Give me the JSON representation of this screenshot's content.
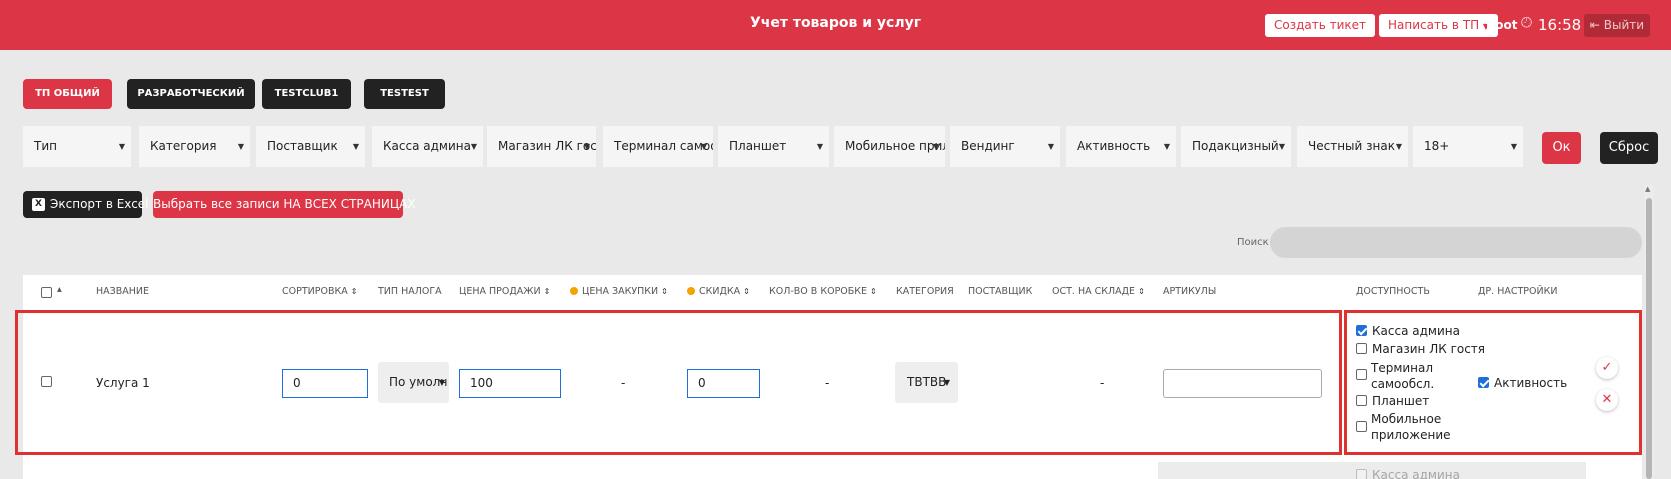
{
  "header": {
    "title": "Учет товаров и услуг",
    "create_ticket": "Создать тикет",
    "write_support": "Написать в ТП",
    "user": "Root",
    "time": "16:58",
    "logout": "Выйти"
  },
  "tabs": [
    {
      "label": "ТП ОБЩИЙ"
    },
    {
      "label": "РАЗРАБОТЧЕСКИЙ"
    },
    {
      "label": "TESTCLUB1"
    },
    {
      "label": "TESTEST"
    }
  ],
  "filters": [
    {
      "label": "Тип"
    },
    {
      "label": "Категория"
    },
    {
      "label": "Поставщик"
    },
    {
      "label": "Касса админа"
    },
    {
      "label": "Магазин ЛК гостя"
    },
    {
      "label": "Терминал самообс"
    },
    {
      "label": "Планшет"
    },
    {
      "label": "Мобильное прило"
    },
    {
      "label": "Вендинг"
    },
    {
      "label": "Активность"
    },
    {
      "label": "Подакцизный"
    },
    {
      "label": "Честный знак"
    },
    {
      "label": "18+"
    }
  ],
  "filter_buttons": {
    "ok": "Ок",
    "reset": "Сброс"
  },
  "actions": {
    "export_excel": "Экспорт в Excel",
    "select_all_pages": "Выбрать все записи НА ВСЕХ СТРАНИЦАХ"
  },
  "search": {
    "label": "Поиск",
    "placeholder": ""
  },
  "columns": {
    "name": "НАЗВАНИЕ",
    "sort": "СОРТИРОВКА",
    "tax_type": "ТИП НАЛОГА",
    "sale_price": "ЦЕНА ПРОДАЖИ",
    "purchase_price": "ЦЕНА ЗАКУПКИ",
    "discount": "СКИДКА",
    "box_qty": "КОЛ-ВО В КОРОБКЕ",
    "category": "КАТЕГОРИЯ",
    "supplier": "ПОСТАВЩИК",
    "stock": "ОСТ. НА СКЛАДЕ",
    "articles": "АРТИКУЛЫ",
    "availability": "ДОСТУПНОСТЬ",
    "other_settings": "ДР. НАСТРОЙКИ"
  },
  "row": {
    "name": "Услуга 1",
    "sort": "0",
    "tax_type": "По умолч",
    "sale_price": "100",
    "purchase_price": "-",
    "discount": "0",
    "box_qty": "-",
    "category": "ТВТВВ",
    "stock": "-",
    "articles": "",
    "availability": [
      {
        "label": "Касса админа",
        "checked": true
      },
      {
        "label": "Магазин ЛК гостя",
        "checked": false
      },
      {
        "label_line1": "Терминал",
        "label_line2": "самообсл.",
        "checked": false
      },
      {
        "label": "Планшет",
        "checked": false
      },
      {
        "label_line1": "Мобильное",
        "label_line2": "приложение",
        "checked": false
      }
    ],
    "activity": {
      "label": "Активность",
      "checked": true
    }
  },
  "next_row": {
    "availability_first": "Касса админа"
  },
  "icons": {
    "clock": "clock-icon",
    "logout": "logout-icon",
    "excel": "excel-icon",
    "confirm": "check-icon",
    "cancel": "close-icon"
  },
  "colors": {
    "brand": "#dc3545",
    "dark": "#222222",
    "focus": "#1e6fd9",
    "highlight": "#e03131"
  }
}
